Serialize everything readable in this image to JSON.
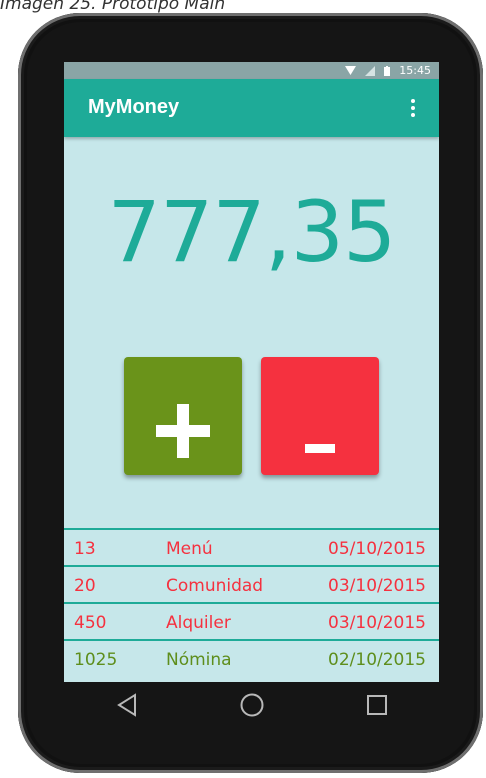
{
  "caption": "Imagen 25. Prototipo Main",
  "status_bar": {
    "time": "15:45",
    "icons": [
      "wifi-icon",
      "signal-icon",
      "battery-icon"
    ]
  },
  "app_bar": {
    "title": "MyMoney",
    "menu_icon": "overflow-menu-icon"
  },
  "balance": "777,35",
  "actions": {
    "add_label": "+",
    "subtract_label": "-"
  },
  "transactions": [
    {
      "amount": "13",
      "concept": "Menú",
      "date": "05/10/2015",
      "type": "expense"
    },
    {
      "amount": "20",
      "concept": "Comunidad",
      "date": "03/10/2015",
      "type": "expense"
    },
    {
      "amount": "450",
      "concept": "Alquiler",
      "date": "03/10/2015",
      "type": "expense"
    },
    {
      "amount": "1025",
      "concept": "Nómina",
      "date": "02/10/2015",
      "type": "income"
    }
  ],
  "nav_bar": {
    "icons": [
      "back-icon",
      "home-icon",
      "recents-icon"
    ]
  },
  "colors": {
    "accent": "#1eab98",
    "screen_bg": "#c6e7ea",
    "add_button": "#6a931a",
    "subtract_button": "#f5313f",
    "expense_text": "#f5313f",
    "income_text": "#5e8e1c"
  }
}
